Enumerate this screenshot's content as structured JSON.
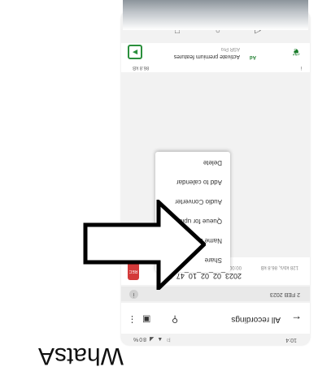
{
  "status_bar": {
    "time": "10:4",
    "icons": "⚐ ▲ ◢ 80%"
  },
  "app_bar": {
    "title": "All recordings",
    "back_icon": "arrow-left-icon"
  },
  "date_header": {
    "date": "2 FEB 2023",
    "info_icon": "info-icon"
  },
  "recording": {
    "badge": "REC",
    "name": "2023_02_02_10_47_50",
    "duration": "00:00",
    "size_info": "128 kb/s, 86.8 kB",
    "extra": "86.8 kB"
  },
  "context_menu": {
    "items": [
      "Share",
      "Name & tags",
      "Queue for upload",
      "Audio Converter",
      "Add to calendar",
      "Delete"
    ]
  },
  "ad": {
    "title": "Activate premium features",
    "subtitle": "ASR Pro",
    "badge": "Ad",
    "size_left": "86.8 kB",
    "size_right": "i"
  },
  "side_text": "WhatsA",
  "colors": {
    "rec_red": "#d33a3a",
    "brand_green": "#2a8f3c"
  }
}
